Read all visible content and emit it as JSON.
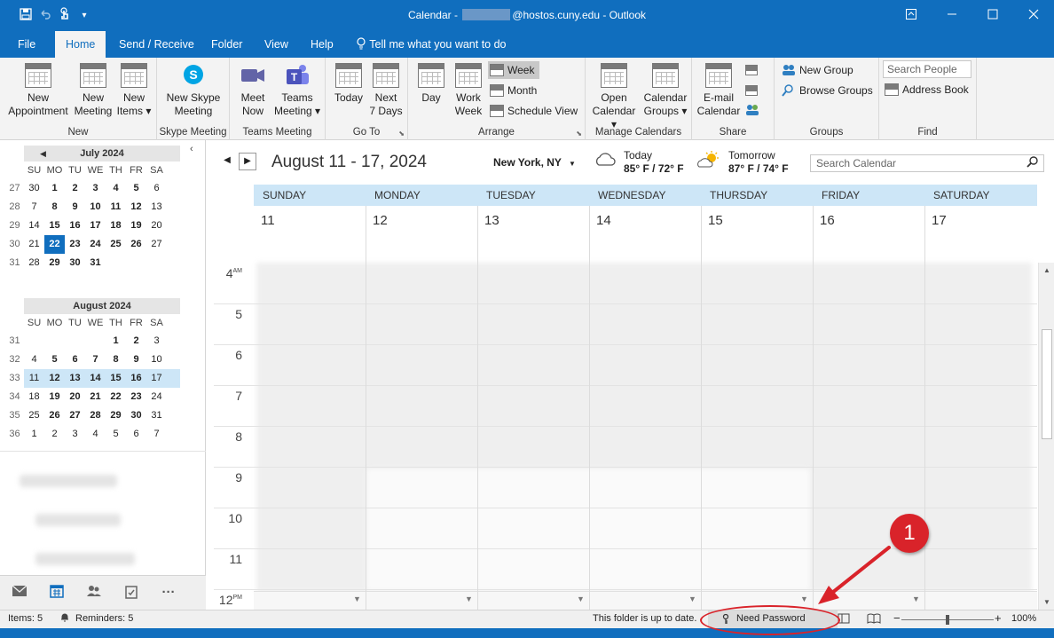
{
  "window": {
    "title_prefix": "Calendar - ",
    "title_suffix": "@hostos.cuny.edu  -  Outlook",
    "icons": [
      "save-icon",
      "undo-icon",
      "touch-mode-icon",
      "customize-icon"
    ]
  },
  "menu": {
    "tabs": [
      "File",
      "Home",
      "Send / Receive",
      "Folder",
      "View",
      "Help"
    ],
    "tell_me": "Tell me what you want to do",
    "active": "Home"
  },
  "ribbon": {
    "new": {
      "appointment": [
        "New",
        "Appointment"
      ],
      "meeting": [
        "New",
        "Meeting"
      ],
      "items": [
        "New",
        "Items ▾"
      ],
      "label": "New"
    },
    "skype": {
      "btn": [
        "New Skype",
        "Meeting"
      ],
      "label": "Skype Meeting"
    },
    "teams": {
      "meet": [
        "Meet",
        "Now"
      ],
      "meeting": [
        "Teams",
        "Meeting ▾"
      ],
      "label": "Teams Meeting"
    },
    "goto": {
      "today": "Today",
      "next7": [
        "Next",
        "7 Days"
      ],
      "label": "Go To"
    },
    "arrange": {
      "day": "Day",
      "workweek": [
        "Work",
        "Week"
      ],
      "week": "Week",
      "month": "Month",
      "schedule": "Schedule View",
      "label": "Arrange"
    },
    "manage": {
      "open": [
        "Open",
        "Calendar ▾"
      ],
      "groups": [
        "Calendar",
        "Groups ▾"
      ],
      "label": "Manage Calendars"
    },
    "share": {
      "email": [
        "E-mail",
        "Calendar"
      ],
      "label": "Share"
    },
    "groups": {
      "new": "New Group",
      "browse": "Browse Groups",
      "label": "Groups"
    },
    "find": {
      "search_placeholder": "Search People",
      "address": "Address Book",
      "label": "Find"
    }
  },
  "minical_july": {
    "title": "July 2024",
    "dow": [
      "SU",
      "MO",
      "TU",
      "WE",
      "TH",
      "FR",
      "SA"
    ],
    "weeks": [
      {
        "num": "27",
        "days": [
          "30",
          "1",
          "2",
          "3",
          "4",
          "5",
          "6"
        ]
      },
      {
        "num": "28",
        "days": [
          "7",
          "8",
          "9",
          "10",
          "11",
          "12",
          "13"
        ]
      },
      {
        "num": "29",
        "days": [
          "14",
          "15",
          "16",
          "17",
          "18",
          "19",
          "20"
        ]
      },
      {
        "num": "30",
        "days": [
          "21",
          "22",
          "23",
          "24",
          "25",
          "26",
          "27"
        ]
      },
      {
        "num": "31",
        "days": [
          "28",
          "29",
          "30",
          "31",
          "",
          "",
          ""
        ]
      }
    ]
  },
  "minical_august": {
    "title": "August 2024",
    "dow": [
      "SU",
      "MO",
      "TU",
      "WE",
      "TH",
      "FR",
      "SA"
    ],
    "weeks": [
      {
        "num": "31",
        "days": [
          "",
          "",
          "",
          "",
          "1",
          "2",
          "3"
        ]
      },
      {
        "num": "32",
        "days": [
          "4",
          "5",
          "6",
          "7",
          "8",
          "9",
          "10"
        ]
      },
      {
        "num": "33",
        "days": [
          "11",
          "12",
          "13",
          "14",
          "15",
          "16",
          "17"
        ]
      },
      {
        "num": "34",
        "days": [
          "18",
          "19",
          "20",
          "21",
          "22",
          "23",
          "24"
        ]
      },
      {
        "num": "35",
        "days": [
          "25",
          "26",
          "27",
          "28",
          "29",
          "30",
          "31"
        ]
      },
      {
        "num": "36",
        "days": [
          "1",
          "2",
          "3",
          "4",
          "5",
          "6",
          "7"
        ]
      }
    ]
  },
  "navbar": {
    "icons": [
      "mail-icon",
      "calendar-icon",
      "people-icon",
      "tasks-icon",
      "more-icon"
    ]
  },
  "calendar": {
    "range": "August 11 - 17, 2024",
    "location": "New York, NY",
    "today": {
      "label": "Today",
      "temp": "85° F / 72° F",
      "icon": "cloudy-icon"
    },
    "tomorrow": {
      "label": "Tomorrow",
      "temp": "87° F / 74° F",
      "icon": "partly-sunny-icon"
    },
    "search_placeholder": "Search Calendar",
    "days": [
      {
        "name": "SUNDAY",
        "num": "11"
      },
      {
        "name": "MONDAY",
        "num": "12"
      },
      {
        "name": "TUESDAY",
        "num": "13"
      },
      {
        "name": "WEDNESDAY",
        "num": "14"
      },
      {
        "name": "THURSDAY",
        "num": "15"
      },
      {
        "name": "FRIDAY",
        "num": "16"
      },
      {
        "name": "SATURDAY",
        "num": "17"
      }
    ],
    "hours": [
      {
        "h": "4",
        "ampm": "AM"
      },
      {
        "h": "5",
        "ampm": ""
      },
      {
        "h": "6",
        "ampm": ""
      },
      {
        "h": "7",
        "ampm": ""
      },
      {
        "h": "8",
        "ampm": ""
      },
      {
        "h": "9",
        "ampm": ""
      },
      {
        "h": "10",
        "ampm": ""
      },
      {
        "h": "11",
        "ampm": ""
      },
      {
        "h": "12",
        "ampm": "PM"
      }
    ]
  },
  "status": {
    "items": "Items: 5",
    "reminders": "Reminders: 5",
    "folder": "This folder is up to date.",
    "need_password": "Need Password",
    "zoom": "100%",
    "zoom_minus": "−",
    "zoom_plus": "+"
  },
  "annotation": {
    "badge": "1",
    "color": "#d9232a"
  }
}
